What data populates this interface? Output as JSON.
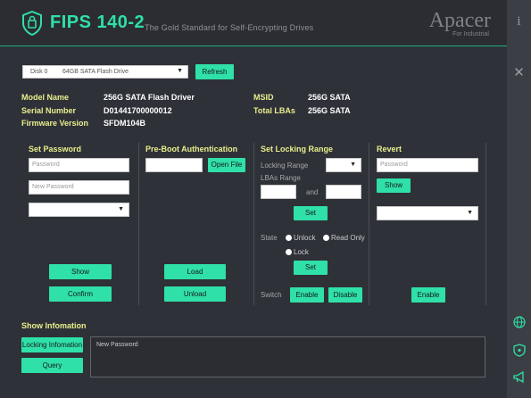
{
  "header": {
    "title": "FIPS 140-2",
    "subtitle": "The Gold Standard for Self-Encrypting Drives",
    "brand": "Apacer",
    "brand_sub": "For Industrial"
  },
  "sidebar_right": {
    "info_glyph": "i",
    "close_glyph": "✕",
    "icons": [
      "globe-icon",
      "shield-icon",
      "megaphone-icon"
    ]
  },
  "disk": {
    "selected": "Disk 0",
    "model": "64GB SATA Flash Drive",
    "refresh_label": "Refresh"
  },
  "device_info": {
    "model_name_label": "Model Name",
    "model_name_value": "256G SATA Flash Driver",
    "serial_label": "Serial Number",
    "serial_value": "D01441700000012",
    "firmware_label": "Firmware Version",
    "firmware_value": "SFDM104B",
    "msid_label": "MSID",
    "msid_value": "256G SATA",
    "total_lbas_label": "Total LBAs",
    "total_lbas_value": "256G SATA"
  },
  "set_password": {
    "title": "Set Password",
    "password_placeholder": "Password",
    "new_password_placeholder": "New Password",
    "select_value": "",
    "show_label": "Show",
    "confirm_label": "Confirm"
  },
  "pre_boot": {
    "title": "Pre-Boot Authentication",
    "file_value": "",
    "open_file_label": "Open File",
    "load_label": "Load",
    "unload_label": "Unload"
  },
  "locking_range": {
    "title": "Set Locking Range",
    "locking_range_label": "Locking Range",
    "lbas_range_label": "LBAs Range",
    "and_label": "and",
    "set_label": "Set",
    "state_label": "State",
    "unlock_label": "Unlock",
    "read_only_label": "Read Only",
    "lock_label": "Lock",
    "set2_label": "Set",
    "switch_label": "Switch",
    "enable_label": "Enable",
    "disable_label": "Disable"
  },
  "revert": {
    "title": "Revert",
    "password_placeholder": "Password",
    "show_label": "Show",
    "select_value": "",
    "enable_label": "Enable"
  },
  "show_info": {
    "title": "Show Infomation",
    "locking_info_label": "Locking Infomation",
    "query_label": "Query",
    "output_text": "New Password"
  },
  "colors": {
    "accent": "#2fe0a8",
    "label_yellow": "#e8ee8c",
    "background": "#2f3138"
  }
}
